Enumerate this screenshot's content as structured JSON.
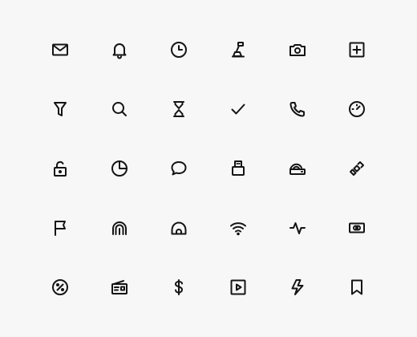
{
  "theme": {
    "background": "#f7f7f7",
    "icon_color": "#141414"
  },
  "icons": [
    [
      "mail-icon",
      "bell-icon",
      "clock-icon",
      "microscope-icon",
      "camera-icon",
      "plus-square-icon"
    ],
    [
      "filter-icon",
      "search-icon",
      "hourglass-icon",
      "check-icon",
      "phone-icon",
      "speedometer-icon"
    ],
    [
      "lock-open-icon",
      "pie-chart-icon",
      "chat-bubble-icon",
      "usb-drive-icon",
      "router-icon",
      "satellite-icon"
    ],
    [
      "flag-icon",
      "fingerprint-icon",
      "tent-icon",
      "wifi-icon",
      "activity-icon",
      "cash-icon"
    ],
    [
      "percent-badge-icon",
      "radio-icon",
      "dollar-icon",
      "play-square-icon",
      "lightning-icon",
      "bookmark-icon"
    ]
  ]
}
